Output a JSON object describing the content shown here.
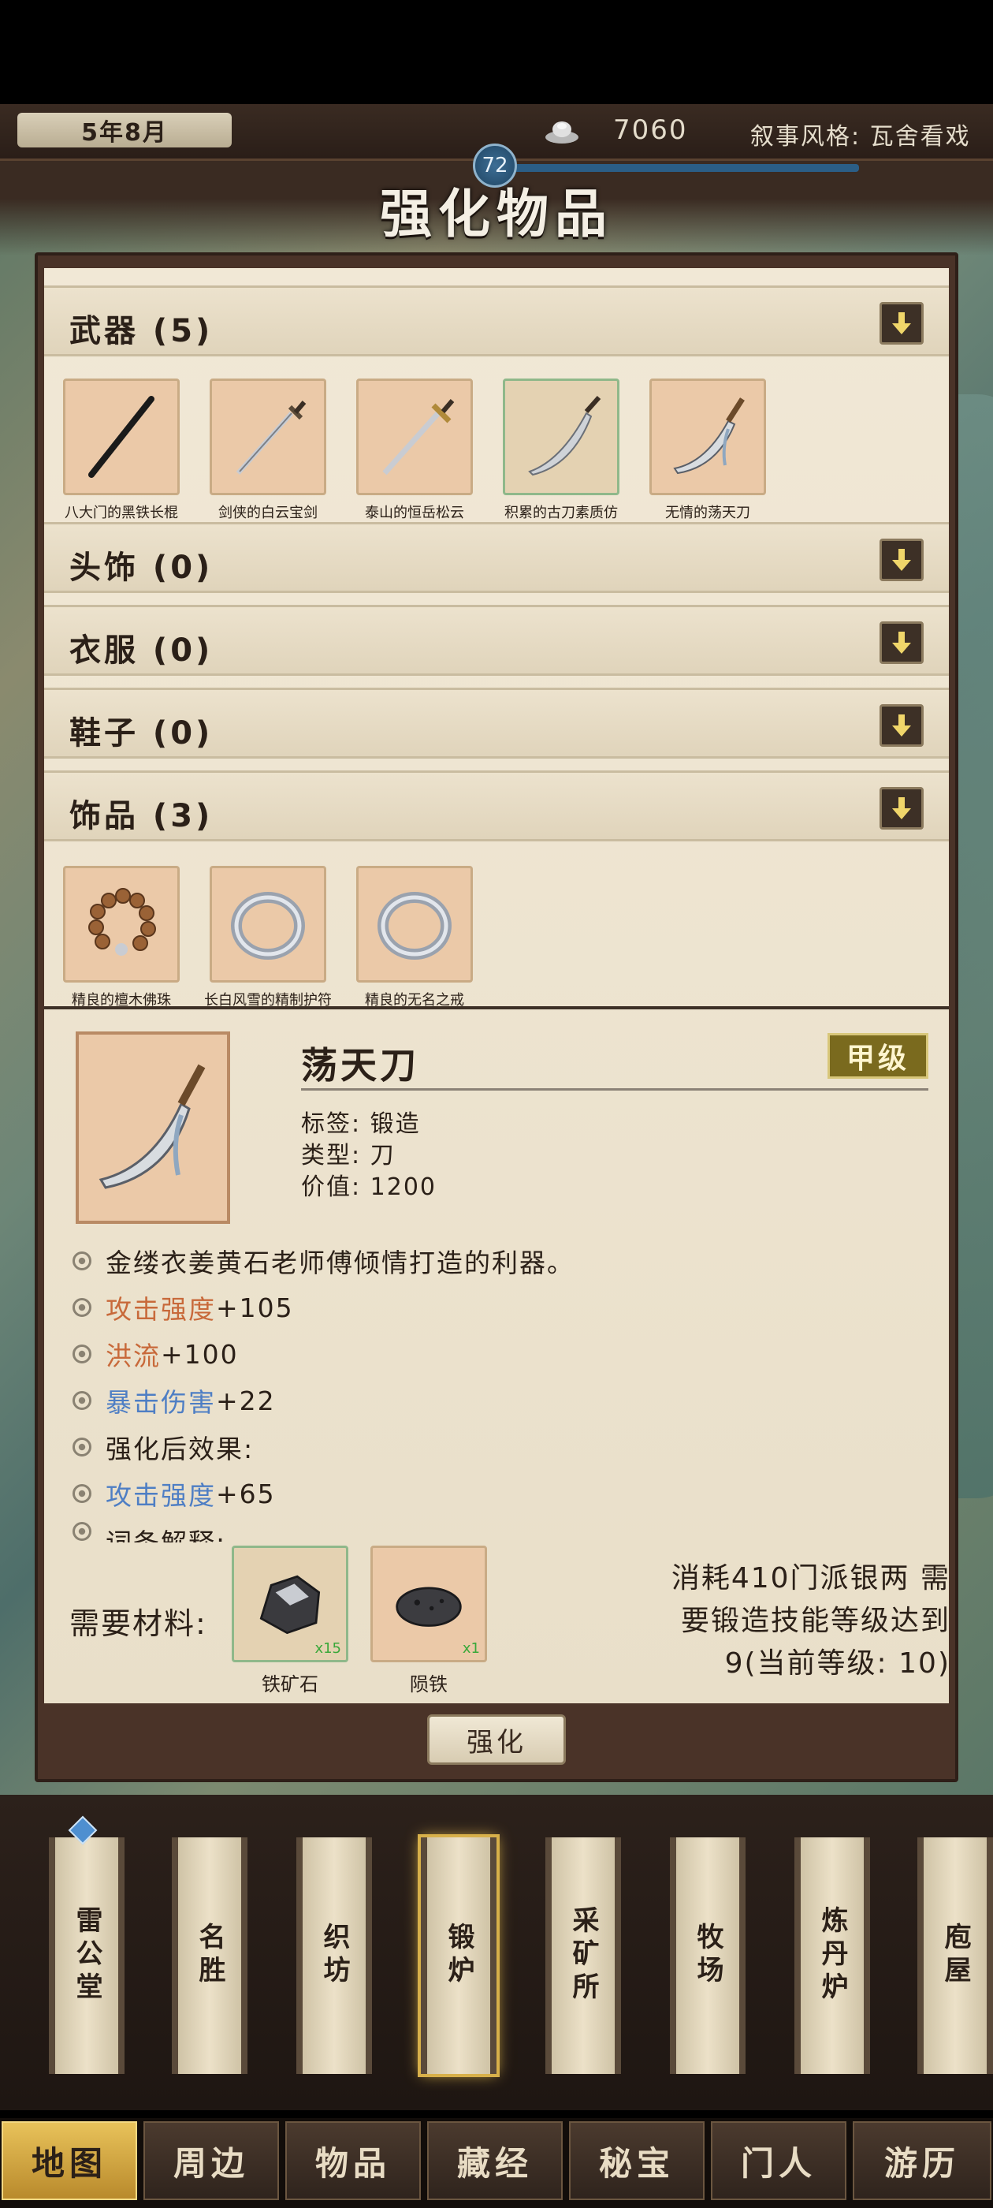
{
  "header": {
    "date": "5年8月",
    "silver": "7060",
    "narrative_style": "叙事风格: 瓦舍看戏",
    "level": "72",
    "title": "强化物品"
  },
  "categories": [
    {
      "label": "武器 (5)"
    },
    {
      "label": "头饰 (0)"
    },
    {
      "label": "衣服 (0)"
    },
    {
      "label": "鞋子 (0)"
    },
    {
      "label": "饰品 (3)"
    }
  ],
  "weapons": [
    {
      "name": "八大门的黑铁长棍",
      "icon": "staff-icon"
    },
    {
      "name": "剑侠的白云宝剑",
      "icon": "sword-icon"
    },
    {
      "name": "泰山的恒岳松云",
      "icon": "sword-icon"
    },
    {
      "name": "积累的古刀素质仿",
      "icon": "saber-icon"
    },
    {
      "name": "无情的荡天刀",
      "icon": "saber-icon"
    }
  ],
  "accessories": [
    {
      "name": "精良的檀木佛珠",
      "icon": "prayer-beads-icon"
    },
    {
      "name": "长白风雪的精制护符",
      "icon": "ring-icon"
    },
    {
      "name": "精良的无名之戒",
      "icon": "ring-icon"
    }
  ],
  "detail": {
    "name": "荡天刀",
    "grade": "甲级",
    "tag": "标签: 锻造",
    "type": "类型: 刀",
    "value": "价值: 1200",
    "description": "金缕衣姜黄石老师傅倾情打造的利器。",
    "stats": [
      {
        "name": "攻击强度",
        "value": "+105",
        "color": "#c8693a"
      },
      {
        "name": "洪流",
        "value": "+100",
        "color": "#c8693a"
      },
      {
        "name": "暴击伤害",
        "value": "+22",
        "color": "#4e7ec4"
      }
    ],
    "after_label": "强化后效果:",
    "after_stat": {
      "name": "攻击强度",
      "value": "+65",
      "color": "#4e7ec4"
    },
    "more_label": "词条解释:"
  },
  "materials": {
    "label": "需要材料:",
    "items": [
      {
        "name": "铁矿石",
        "count": "x15",
        "icon": "iron-ore-icon"
      },
      {
        "name": "陨铁",
        "count": "x1",
        "icon": "meteor-iron-icon"
      }
    ],
    "cost_line1": "消耗410门派银两 需",
    "cost_line2": "要锻造技能等级达到",
    "cost_line3": "9(当前等级: 10)"
  },
  "strengthen_button": "强化",
  "buildings": [
    {
      "label": "雷公堂"
    },
    {
      "label": "名胜"
    },
    {
      "label": "织坊"
    },
    {
      "label": "锻炉"
    },
    {
      "label": "采矿所"
    },
    {
      "label": "牧场"
    },
    {
      "label": "炼丹炉"
    },
    {
      "label": "庖屋"
    }
  ],
  "nav": [
    {
      "label": "地图"
    },
    {
      "label": "周边"
    },
    {
      "label": "物品"
    },
    {
      "label": "藏经"
    },
    {
      "label": "秘宝"
    },
    {
      "label": "门人"
    },
    {
      "label": "游历"
    }
  ]
}
